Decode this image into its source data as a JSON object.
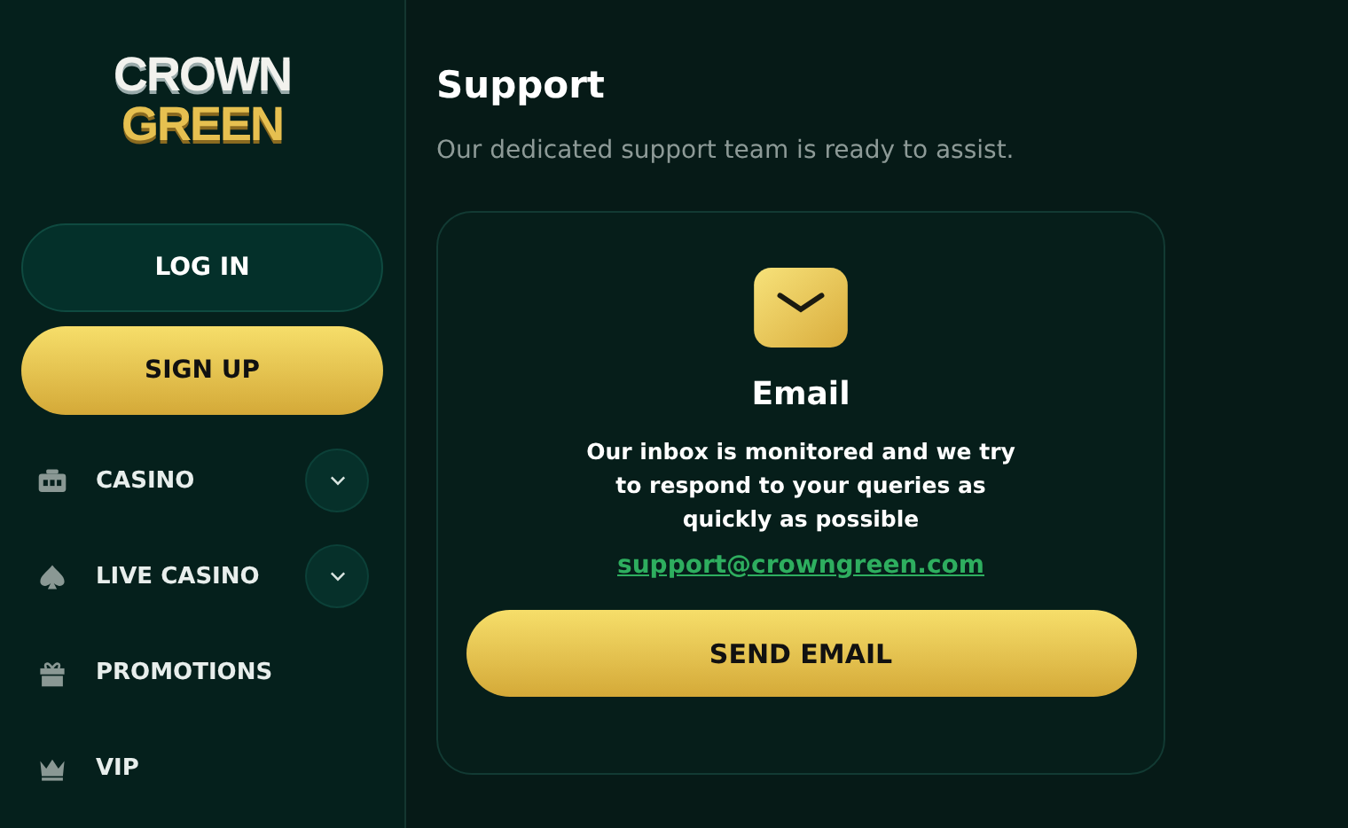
{
  "logo": {
    "lines": [
      "CROWN",
      "GREEN"
    ]
  },
  "auth_buttons": [
    {
      "label": "LOG IN",
      "kind": "outline"
    },
    {
      "label": "SIGN UP",
      "kind": "primary"
    }
  ],
  "nav": [
    {
      "label": "CASINO",
      "has_submenu": true
    },
    {
      "label": "LIVE CASINO",
      "has_submenu": true
    },
    {
      "label": "PROMOTIONS",
      "has_submenu": false
    },
    {
      "label": "VIP",
      "has_submenu": false
    }
  ],
  "page": {
    "title": "Support",
    "subtitle": "Our dedicated support team is ready to assist."
  },
  "card": {
    "title": "Email",
    "text": "Our inbox is monitored and we try to respond to your queries as quickly as possible",
    "link": "support@crowngreen.com",
    "button": "SEND EMAIL"
  }
}
